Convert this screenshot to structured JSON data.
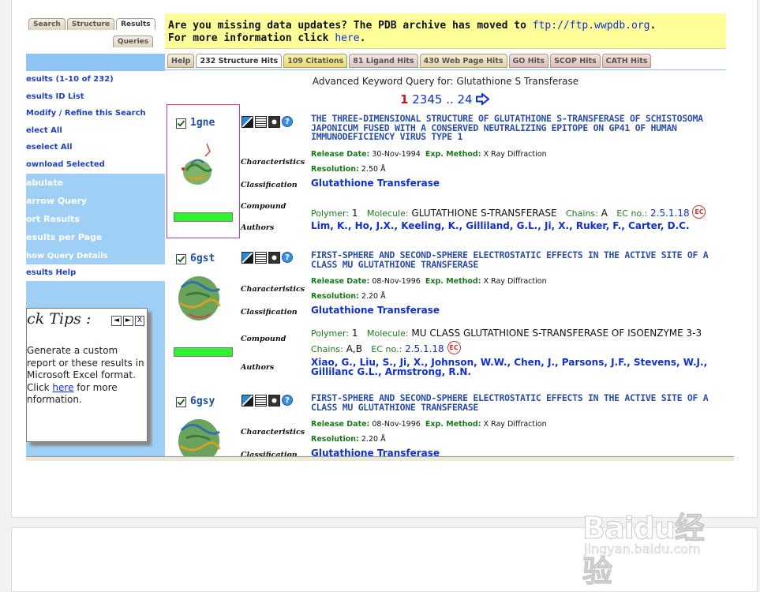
{
  "left_panel": {
    "tabs": [
      "Search",
      "Structure",
      "Results"
    ],
    "tab_queries": "Queries",
    "menu": [
      "esults (1-10 of 232)",
      "esults ID List",
      "Modify / Refine this Search",
      "elect All",
      "eselect All",
      "ownload Selected"
    ],
    "menu2": [
      "abulate",
      "arrow Query",
      "ort Results",
      "esults per Page"
    ],
    "menu3": [
      "how Query Details",
      "esults Help"
    ],
    "quick_tips": {
      "title": "ick Tips :",
      "nav_prev": "◄",
      "nav_next": "►",
      "close": "X",
      "text_before": "Generate a custom report or these results in Microsoft Excel format. Click ",
      "link": "here",
      "text_after": " for more nformation."
    }
  },
  "banner": {
    "line1": "Are you missing data updates? The PDB archive has moved to ",
    "line1_link": "ftp://ftp.wwpdb.org",
    "line1_end": ".",
    "line2": "For more information click ",
    "line2_link": "here",
    "line2_end": "."
  },
  "result_tabs": [
    "Help",
    "232 Structure Hits",
    "109 Citations",
    "81 Ligand Hits",
    "430 Web Page Hits",
    "GO Hits",
    "SCOP Hits",
    "CATH Hits"
  ],
  "query_line": "Advanced Keyword Query for: Glutathione S Transferase",
  "pager": {
    "current": "1",
    "pages": [
      "2",
      "3",
      "4",
      "5"
    ],
    "ellipsis": "..",
    "last": "24"
  },
  "labels": {
    "characteristics": "Characteristics",
    "classification": "Classification",
    "compound": "Compound",
    "authors": "Authors",
    "release_date": "Release Date:",
    "exp_method": "Exp. Method:",
    "resolution": "Resolution:",
    "polymer": "Polymer:",
    "molecule": "Molecule:",
    "chains": "Chains:",
    "ec_no": "EC no.:",
    "ec_badge": "EC"
  },
  "entries": [
    {
      "id": "1gne",
      "title": "THE THREE-DIMENSIONAL STRUCTURE OF GLUTATHIONE S-TRANSFERASE OF SCHISTOSOMA JAPONICUM FUSED WITH A CONSERVED NEUTRALIZING EPITOPE ON GP41 OF HUMAN IMMUNODEFICIENCY VIRUS TYPE 1",
      "release_date": "30-Nov-1994",
      "exp_method": "X Ray Diffraction",
      "resolution": "2.50 Å",
      "classification": "Glutathione Transferase",
      "polymer": "1",
      "molecule": "GLUTATHIONE S-TRANSFERASE",
      "chains": "A",
      "ec": "2.5.1.18",
      "authors": "Lim, K., Ho, J.X., Keeling, K., Gilliland, G.L., Ji, X., Ruker, F., Carter, D.C."
    },
    {
      "id": "6gst",
      "title": "FIRST-SPHERE AND SECOND-SPHERE ELECTROSTATIC EFFECTS IN THE ACTIVE SITE OF A CLASS MU GLUTATHIONE TRANSFERASE",
      "release_date": "08-Nov-1996",
      "exp_method": "X Ray Diffraction",
      "resolution": "2.20 Å",
      "classification": "Glutathione Transferase",
      "polymer": "1",
      "molecule": "MU CLASS GLUTATHIONE S-TRANSFERASE OF ISOENZYME 3-3",
      "chains": "A,B",
      "ec": "2.5.1.18",
      "authors": "Xiao, G., Liu, S., Ji, X., Johnson, W.W., Chen, J., Parsons, J.F., Stevens, W.J., Gillilanc G.L., Armstrong, R.N."
    },
    {
      "id": "6gsy",
      "title": "FIRST-SPHERE AND SECOND-SPHERE ELECTROSTATIC EFFECTS IN THE ACTIVE SITE OF A CLASS MU GLUTATHIONE TRANSFERASE",
      "release_date": "08-Nov-1996",
      "exp_method": "X Ray Diffraction",
      "resolution": "2.20 Å",
      "classification": "Glutathione Transferase"
    }
  ],
  "watermark": {
    "text": "Baidu经验",
    "sub": "jingyan.baidu.com"
  },
  "colors": {
    "link": "#1030d0",
    "menu_blue": "#9fcff5",
    "banner_yellow": "#ffff99",
    "select_border": "#e0338f",
    "score_green": "#2ef22e"
  }
}
